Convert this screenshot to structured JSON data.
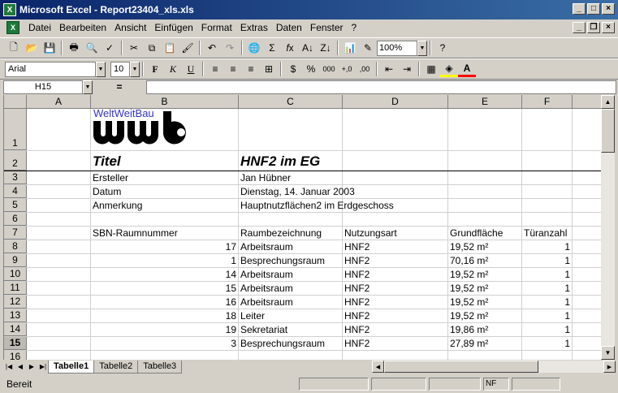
{
  "window": {
    "title": "Microsoft Excel - Report23404_xls.xls",
    "app_badge": "X"
  },
  "menu": [
    "Datei",
    "Bearbeiten",
    "Ansicht",
    "Einfügen",
    "Format",
    "Extras",
    "Daten",
    "Fenster",
    "?"
  ],
  "toolbar": {
    "zoom": "100%",
    "font": "Arial",
    "font_size": "10"
  },
  "formula": {
    "cell_ref": "H15",
    "equals": "=",
    "content": ""
  },
  "columns": [
    "A",
    "B",
    "C",
    "D",
    "E",
    "F"
  ],
  "logo": {
    "caption": "WeltWeitBau",
    "mark": "wwb"
  },
  "rows": [
    {
      "n": "1",
      "b": "",
      "c": "",
      "d": "",
      "e": "",
      "f": ""
    },
    {
      "n": "2",
      "b": "Titel",
      "c": "HNF2 im EG",
      "d": "",
      "e": "",
      "f": ""
    },
    {
      "n": "3",
      "b": "Ersteller",
      "c": "Jan Hübner",
      "d": "",
      "e": "",
      "f": ""
    },
    {
      "n": "4",
      "b": "Datum",
      "c": "Dienstag, 14. Januar 2003",
      "d": "",
      "e": "",
      "f": ""
    },
    {
      "n": "5",
      "b": "Anmerkung",
      "c": "Hauptnutzflächen2 im Erdgeschoss",
      "d": "",
      "e": "",
      "f": ""
    },
    {
      "n": "6",
      "b": "",
      "c": "",
      "d": "",
      "e": "",
      "f": ""
    },
    {
      "n": "7",
      "b": "SBN-Raumnummer",
      "c": "Raumbezeichnung",
      "d": "Nutzungsart",
      "e": "Grundfläche",
      "f": "Türanzahl"
    },
    {
      "n": "8",
      "b": "17",
      "c": "Arbeitsraum",
      "d": "HNF2",
      "e": "19,52 m²",
      "f": "1"
    },
    {
      "n": "9",
      "b": "1",
      "c": "Besprechungsraum",
      "d": "HNF2",
      "e": "70,16 m²",
      "f": "1"
    },
    {
      "n": "10",
      "b": "14",
      "c": "Arbeitsraum",
      "d": "HNF2",
      "e": "19,52 m²",
      "f": "1"
    },
    {
      "n": "11",
      "b": "15",
      "c": "Arbeitsraum",
      "d": "HNF2",
      "e": "19,52 m²",
      "f": "1"
    },
    {
      "n": "12",
      "b": "16",
      "c": "Arbeitsraum",
      "d": "HNF2",
      "e": "19,52 m²",
      "f": "1"
    },
    {
      "n": "13",
      "b": "18",
      "c": "Leiter",
      "d": "HNF2",
      "e": "19,52 m²",
      "f": "1"
    },
    {
      "n": "14",
      "b": "19",
      "c": "Sekretariat",
      "d": "HNF2",
      "e": "19,86 m²",
      "f": "1"
    },
    {
      "n": "15",
      "b": "3",
      "c": "Besprechungsraum",
      "d": "HNF2",
      "e": "27,89 m²",
      "f": "1"
    },
    {
      "n": "16",
      "b": "",
      "c": "",
      "d": "",
      "e": "",
      "f": ""
    }
  ],
  "sheets": [
    "Tabelle1",
    "Tabelle2",
    "Tabelle3"
  ],
  "status": {
    "text": "Bereit",
    "nf": "NF"
  }
}
